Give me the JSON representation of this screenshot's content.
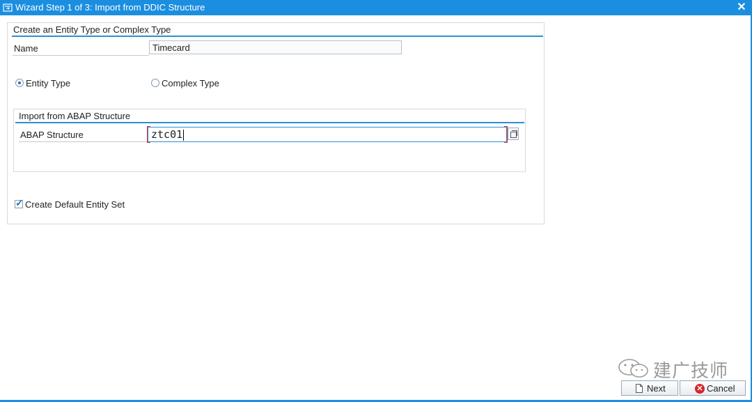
{
  "window": {
    "title": "Wizard Step 1 of 3: Import from DDIC Structure",
    "close_label": "✕"
  },
  "main_group": {
    "title": "Create an Entity Type or Complex Type",
    "name_label": "Name",
    "name_value": "Timecard"
  },
  "type_options": {
    "entity_label": "Entity Type",
    "entity_selected": true,
    "complex_label": "Complex Type",
    "complex_selected": false
  },
  "import_group": {
    "title": "Import from ABAP Structure",
    "structure_label": "ABAP Structure",
    "structure_value": "ztc01"
  },
  "default_entity_set": {
    "label": "Create Default Entity Set",
    "checked": true
  },
  "watermark": {
    "text": "建广技师"
  },
  "buttons": {
    "next_label": "Next",
    "cancel_label": "Cancel"
  },
  "colors": {
    "titlebar": "#1b8ee0",
    "section_line": "#2d8fcf",
    "cancel_icon": "#d6262b"
  }
}
